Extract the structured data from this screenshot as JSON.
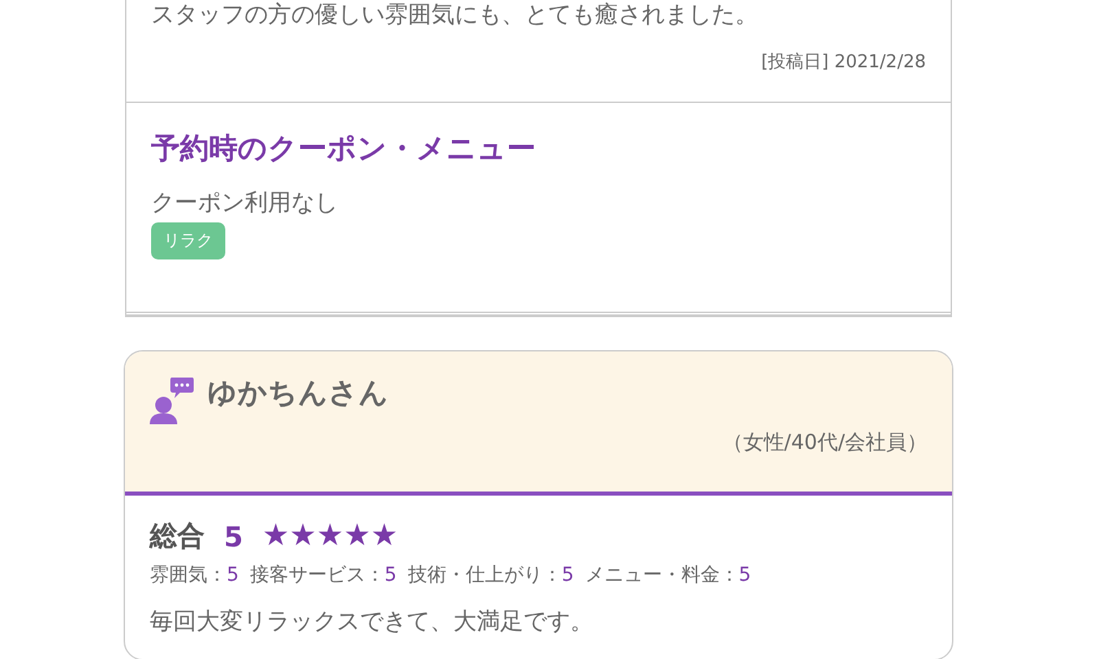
{
  "previous_review": {
    "comment_end": "スタッフの方の優しい雰囲気にも、とても癒されました。",
    "posted_date": "[投稿日] 2021/2/28",
    "coupon_section": {
      "heading": "予約時のクーポン・メニュー",
      "coupon": "クーポン利用なし",
      "tags": [
        "リラク"
      ]
    }
  },
  "review": {
    "reviewer_name": "ゆかちんさん",
    "profile": "（女性/40代/会社員）",
    "overall_label": "総合",
    "overall_score": "5",
    "stars": 5,
    "sub_ratings": [
      {
        "label": "雰囲気：",
        "score": "5"
      },
      {
        "label": "接客サービス：",
        "score": "5"
      },
      {
        "label": "技術・仕上がり：",
        "score": "5"
      },
      {
        "label": "メニュー・料金：",
        "score": "5"
      }
    ],
    "comment": "毎回大変リラックスできて、大満足です。"
  }
}
